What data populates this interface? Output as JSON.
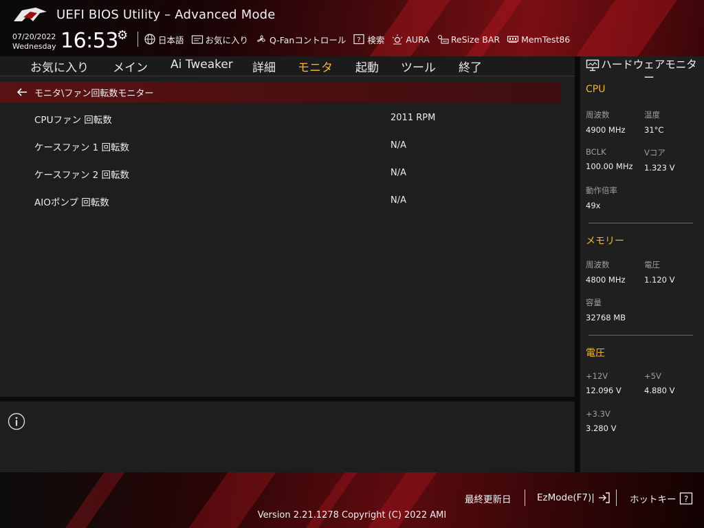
{
  "header": {
    "title": "UEFI BIOS Utility – Advanced Mode",
    "date": "07/20/2022",
    "day": "Wednesday",
    "time": "16:53",
    "tools": [
      {
        "label": "日本語",
        "icon": "globe-icon"
      },
      {
        "label": "お気に入り",
        "icon": "favorites-icon"
      },
      {
        "label": "Q-Fanコントロール",
        "icon": "fan-icon"
      },
      {
        "label": "検索",
        "icon": "help-search-icon"
      },
      {
        "label": "AURA",
        "icon": "aura-light-icon"
      },
      {
        "label": "ReSize BAR",
        "icon": "resize-bar-icon"
      },
      {
        "label": "MemTest86",
        "icon": "memory-icon"
      }
    ]
  },
  "menu": {
    "items": [
      "お気に入り",
      "メイン",
      "Ai Tweaker",
      "詳細",
      "モニタ",
      "起動",
      "ツール",
      "終了"
    ],
    "active": "モニタ"
  },
  "main": {
    "breadcrumb": "モニタ\\ファン回転数モニター",
    "rows": [
      {
        "label": "CPUファン 回転数",
        "value": "2011 RPM"
      },
      {
        "label": "ケースファン 1 回転数",
        "value": "N/A"
      },
      {
        "label": "ケースファン 2 回転数",
        "value": "N/A"
      },
      {
        "label": "AIOポンプ 回転数",
        "value": "N/A"
      }
    ]
  },
  "hwmon": {
    "title": "ハードウェアモニター",
    "cpu": {
      "heading": "CPU",
      "freq_label": "周波数",
      "freq": "4900 MHz",
      "temp_label": "温度",
      "temp": "31°C",
      "bclk_label": "BCLK",
      "bclk": "100.00 MHz",
      "vcore_label": "Vコア",
      "vcore": "1.323 V",
      "ratio_label": "動作倍率",
      "ratio": "49x"
    },
    "memory": {
      "heading": "メモリー",
      "freq_label": "周波数",
      "freq": "4800 MHz",
      "volt_label": "電圧",
      "volt": "1.120 V",
      "cap_label": "容量",
      "cap": "32768 MB"
    },
    "voltage": {
      "heading": "電圧",
      "v12_label": "+12V",
      "v12": "12.096 V",
      "v5_label": "+5V",
      "v5": "4.880 V",
      "v33_label": "+3.3V",
      "v33": "3.280 V"
    }
  },
  "footer": {
    "last_modified": "最終更新日",
    "ezmode": "EzMode(F7)|",
    "hotkeys": "ホットキー",
    "version": "Version 2.21.1278 Copyright (C) 2022 AMI"
  },
  "colors": {
    "accent": "#f0b532",
    "brand_red": "#7a0f14",
    "panel_bg": "#1e1e1e"
  }
}
